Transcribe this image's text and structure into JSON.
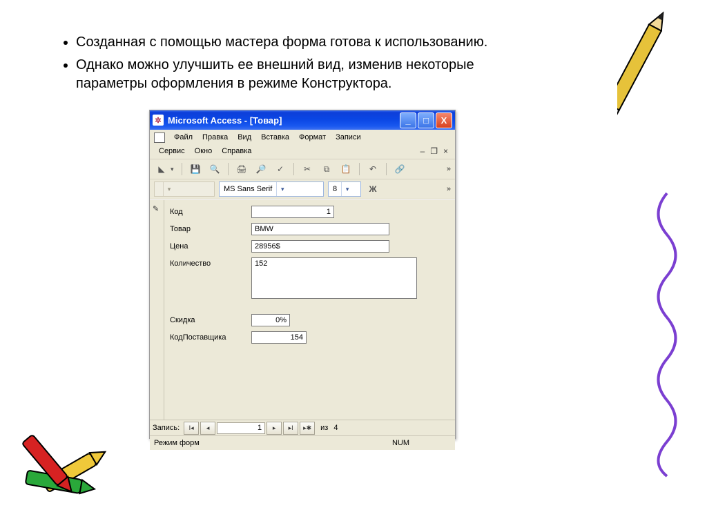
{
  "bullets": [
    "Созданная с помощью мастера форма готова к использованию.",
    "Однако можно улучшить ее внешний вид, изменив некоторые параметры оформления в режиме Конструктора."
  ],
  "window": {
    "title": "Microsoft Access - [Товар]",
    "buttons": {
      "minimize": "_",
      "maximize": "□",
      "close": "X"
    }
  },
  "menu": {
    "items": [
      "Файл",
      "Правка",
      "Вид",
      "Вставка",
      "Формат",
      "Записи",
      "Сервис",
      "Окно",
      "Справка"
    ],
    "mdi": {
      "restore": "❐",
      "close": "×"
    }
  },
  "fontbar": {
    "font": "MS Sans Serif",
    "size": "8",
    "bold": "Ж"
  },
  "fields": {
    "kod_label": "Код",
    "kod_value": "1",
    "tovar_label": "Товар",
    "tovar_value": "BMW",
    "cena_label": "Цена",
    "cena_value": "28956$",
    "kolvo_label": "Количество",
    "kolvo_value": "152",
    "skidka_label": "Скидка",
    "skidka_value": "0%",
    "kodpost_label": "КодПоставщика",
    "kodpost_value": "154"
  },
  "nav": {
    "label": "Запись:",
    "pos": "1",
    "of_label": "из",
    "total": "4"
  },
  "status": {
    "mode": "Режим форм",
    "num": "NUM"
  }
}
